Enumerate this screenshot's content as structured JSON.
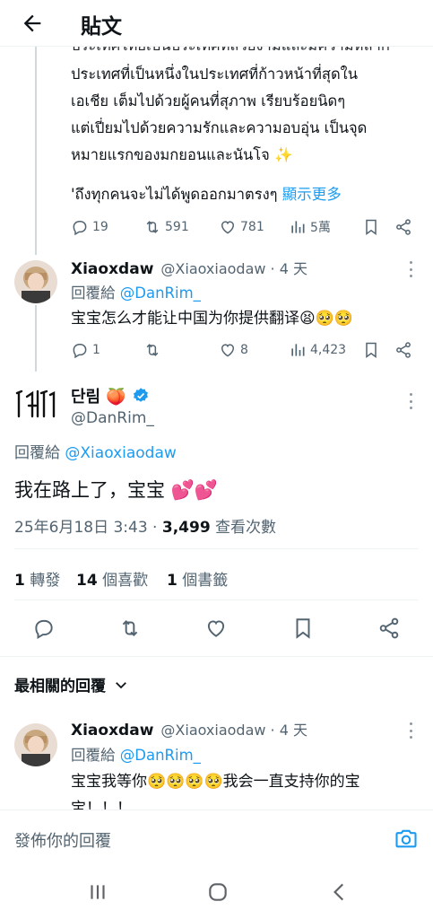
{
  "header": {
    "title": "貼文"
  },
  "thread_tweet": {
    "lines": [
      "ประเทศที่เป็นหนึ่งในประเทศที่ก้าวหน้าที่สุดใน",
      "เอเชีย เต็มไปด้วยผู้คนที่สุภาพ เรียบร้อยนิดๆ",
      "แต่เปี่ยมไปด้วยความรักและความอบอุ่น เป็นจุด",
      "หมายแรกของมกยอนและนันโจ ✨"
    ],
    "last_line": "'ถึงทุกคนจะไม่ได้พูดออกมาตรงๆ",
    "show_more": "顯示更多",
    "replies": "19",
    "reposts": "591",
    "likes": "781",
    "views": "5萬"
  },
  "reply1": {
    "name": "Xiaoxdaw",
    "handle": "@Xiaoxiaodaw · 4 天",
    "reply_to_label": "回覆給",
    "reply_to_handle": "@DanRim_",
    "text": "宝宝怎么才能让中国为你提供翻译😫🥺🥺",
    "replies": "1",
    "likes": "8",
    "views": "4,423"
  },
  "main_tweet": {
    "name": "단림 🍑",
    "handle": "@DanRim_",
    "reply_to_label": "回覆給",
    "reply_to_handle": "@Xiaoxiaodaw",
    "text": "我在路上了，宝宝 💕💕",
    "timestamp": "25年6月18日 3:43 · ",
    "views_count": "3,499",
    "views_label": " 查看次數",
    "reposts_count": "1",
    "reposts_label": " 轉發",
    "likes_count": "14",
    "likes_label": " 個喜歡",
    "bookmarks_count": "1",
    "bookmarks_label": " 個書籤"
  },
  "sort": {
    "label": "最相關的回覆"
  },
  "reply2": {
    "name": "Xiaoxdaw",
    "handle": "@Xiaoxiaodaw · 4 天",
    "reply_to_label": "回覆給",
    "reply_to_handle": "@DanRim_",
    "text_line1": "宝宝我等你🥺🥺🥺🥺我会一直支持你的宝",
    "text_line2": "宝！！！"
  },
  "composer": {
    "placeholder": "發佈你的回覆"
  },
  "colors": {
    "accent": "#1d9bf0",
    "text": "#0f1419",
    "muted": "#536471",
    "verified": "#1d9bf0"
  },
  "icons": [
    "back-arrow-icon",
    "reply-icon",
    "repost-icon",
    "like-icon",
    "views-icon",
    "bookmark-icon",
    "share-icon",
    "verified-icon",
    "chevron-down-icon",
    "camera-icon",
    "more-icon",
    "recent-apps-icon",
    "home-icon",
    "back-nav-icon"
  ]
}
